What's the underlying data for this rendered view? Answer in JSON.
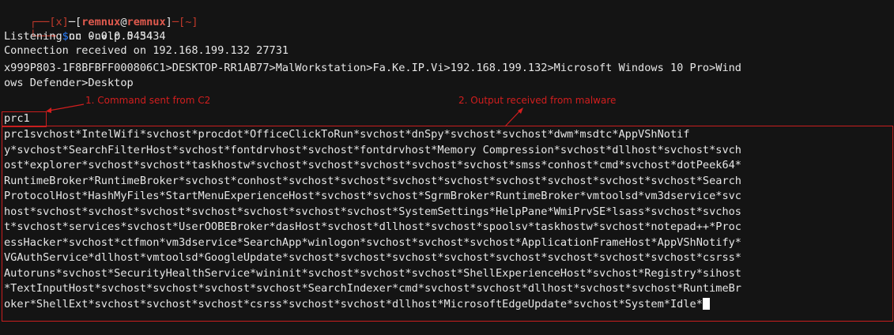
{
  "prompt": {
    "bracket_x": "[x]",
    "user": "remnux",
    "at": "@",
    "host": "remnux",
    "cwd": "[~]",
    "dollar": "$",
    "command": "nc -nvlp 5434"
  },
  "output": {
    "listening": "Listening on 0.0.0.0 5434",
    "connection": "Connection received on 192.168.199.132 27731",
    "beacon_1": "x999P803-1F8BFBFF000806C1>DESKTOP-RR1AB77>MalWorkstation>Fa.Ke.IP.Vi>192.168.199.132>Microsoft Windows 10 Pro>Wind",
    "beacon_2": "ows Defender>Desktop",
    "command_sent": "prc1",
    "process_list": [
      "prc1svchost*IntelWifi*svchost*procdot*OfficeClickToRun*svchost*dnSpy*svchost*svchost*dwm*msdtc*AppVShNotif",
      "y*svchost*SearchFilterHost*svchost*fontdrvhost*svchost*fontdrvhost*Memory Compression*svchost*dllhost*svchost*svch",
      "ost*explorer*svchost*svchost*taskhostw*svchost*svchost*svchost*svchost*svchost*smss*conhost*cmd*svchost*dotPeek64*",
      "RuntimeBroker*RuntimeBroker*svchost*conhost*svchost*svchost*svchost*svchost*svchost*svchost*svchost*svchost*Search",
      "ProtocolHost*HashMyFiles*StartMenuExperienceHost*svchost*svchost*SgrmBroker*RuntimeBroker*vmtoolsd*vm3dservice*svc",
      "host*svchost*svchost*svchost*svchost*svchost*svchost*svchost*SystemSettings*HelpPane*WmiPrvSE*lsass*svchost*svchos",
      "t*svchost*services*svchost*UserOOBEBroker*dasHost*svchost*dllhost*svchost*spoolsv*taskhostw*svchost*notepad++*Proc",
      "essHacker*svchost*ctfmon*vm3dservice*SearchApp*winlogon*svchost*svchost*svchost*ApplicationFrameHost*AppVShNotify*",
      "VGAuthService*dllhost*vmtoolsd*GoogleUpdate*svchost*svchost*svchost*svchost*svchost*svchost*svchost*svchost*csrss*",
      "Autoruns*svchost*SecurityHealthService*wininit*svchost*svchost*svchost*ShellExperienceHost*svchost*Registry*sihost",
      "*TextInputHost*svchost*svchost*svchost*svchost*SearchIndexer*cmd*svchost*svchost*dllhost*svchost*svchost*RuntimeBr",
      "oker*ShellExt*svchost*svchost*svchost*csrss*svchost*svchost*dllhost*MicrosoftEdgeUpdate*svchost*System*Idle*"
    ]
  },
  "annotations": {
    "c2": "1. Command sent from C2",
    "malware": "2. Output received from malware"
  },
  "colors": {
    "background": "#141414",
    "text": "#e6e6e6",
    "annotation": "#d21e1e",
    "prompt_user": "#e05a4e",
    "prompt_frame": "#c0392b",
    "dollar": "#2a7fff"
  }
}
